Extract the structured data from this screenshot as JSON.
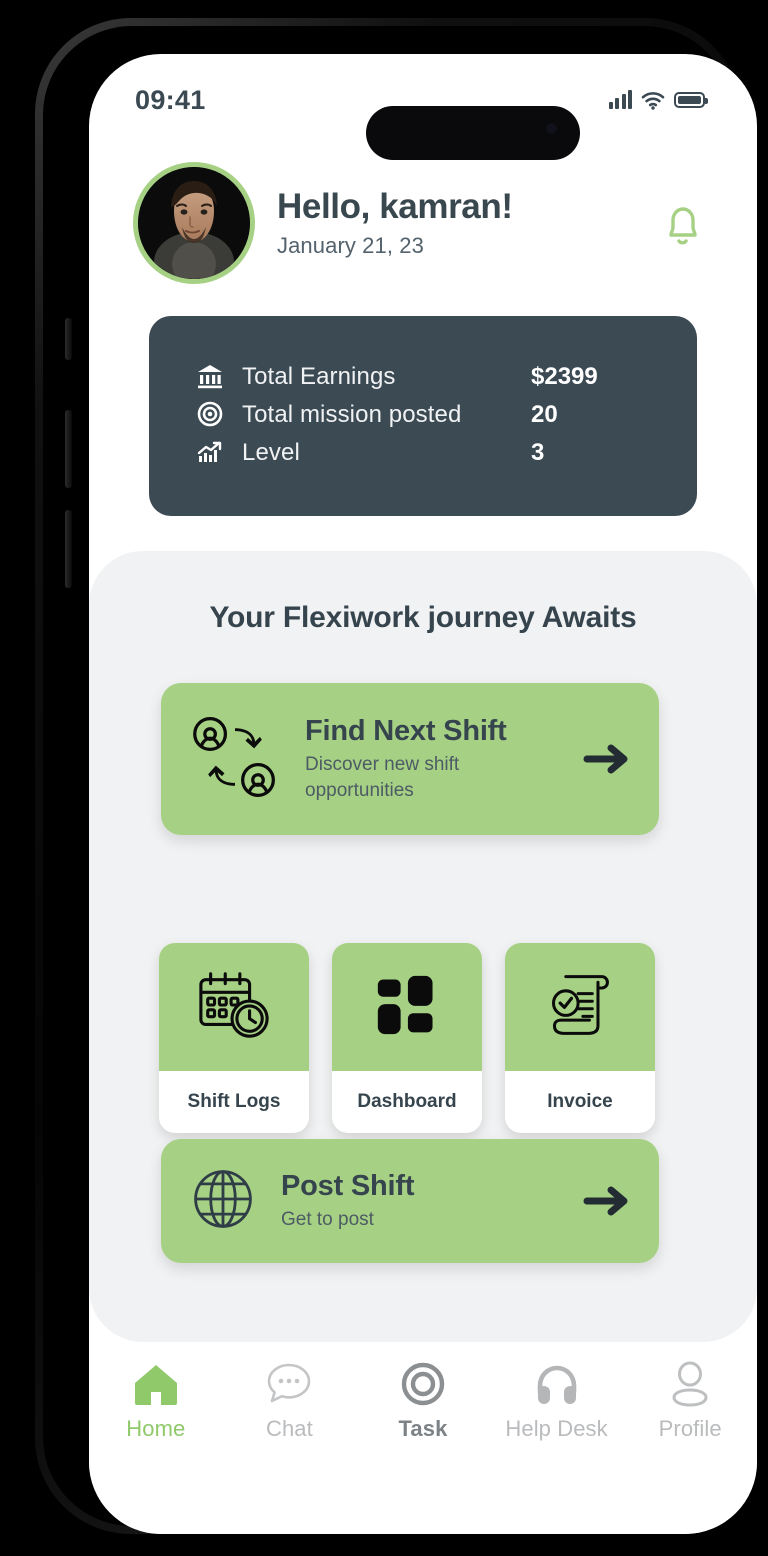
{
  "statusbar": {
    "time": "09:41",
    "icons": [
      "cellular-signal-icon",
      "wifi-icon",
      "battery-icon"
    ]
  },
  "header": {
    "avatar_alt": "user-avatar",
    "greeting": "Hello, kamran!",
    "date": "January 21, 23",
    "bell_icon": "notification-bell-icon"
  },
  "stats": {
    "rows": [
      {
        "icon": "bank-icon",
        "label": "Total Earnings",
        "value": "$2399"
      },
      {
        "icon": "target-icon",
        "label": "Total mission posted",
        "value": "20"
      },
      {
        "icon": "growth-chart-icon",
        "label": "Level",
        "value": "3"
      }
    ]
  },
  "panel": {
    "title": "Your Flexiwork journey Awaits",
    "find_shift": {
      "icon": "shift-swap-icon",
      "title": "Find Next Shift",
      "subtitle": "Discover new shift opportunities",
      "arrow": "arrow-right-icon"
    },
    "tiles": [
      {
        "icon": "calendar-clock-icon",
        "label": "Shift Logs"
      },
      {
        "icon": "grid-squares-icon",
        "label": "Dashboard"
      },
      {
        "icon": "invoice-scroll-icon",
        "label": "Invoice"
      }
    ],
    "post_shift": {
      "icon": "globe-icon",
      "title": "Post Shift",
      "subtitle": "Get to post",
      "arrow": "arrow-right-icon"
    }
  },
  "bottom_nav": {
    "items": [
      {
        "icon": "home-icon",
        "label": "Home",
        "state": "active"
      },
      {
        "icon": "chat-icon",
        "label": "Chat",
        "state": "inactive"
      },
      {
        "icon": "task-target-icon",
        "label": "Task",
        "state": "strong"
      },
      {
        "icon": "headset-icon",
        "label": "Help Desk",
        "state": "inactive"
      },
      {
        "icon": "profile-icon",
        "label": "Profile",
        "state": "inactive"
      }
    ]
  },
  "colors": {
    "green": "#a6d184",
    "green_text": "#8fc96a",
    "dark_slate": "#3c4a54",
    "panel_bg": "#f1f2f3",
    "arrow_dark": "#242c33"
  }
}
